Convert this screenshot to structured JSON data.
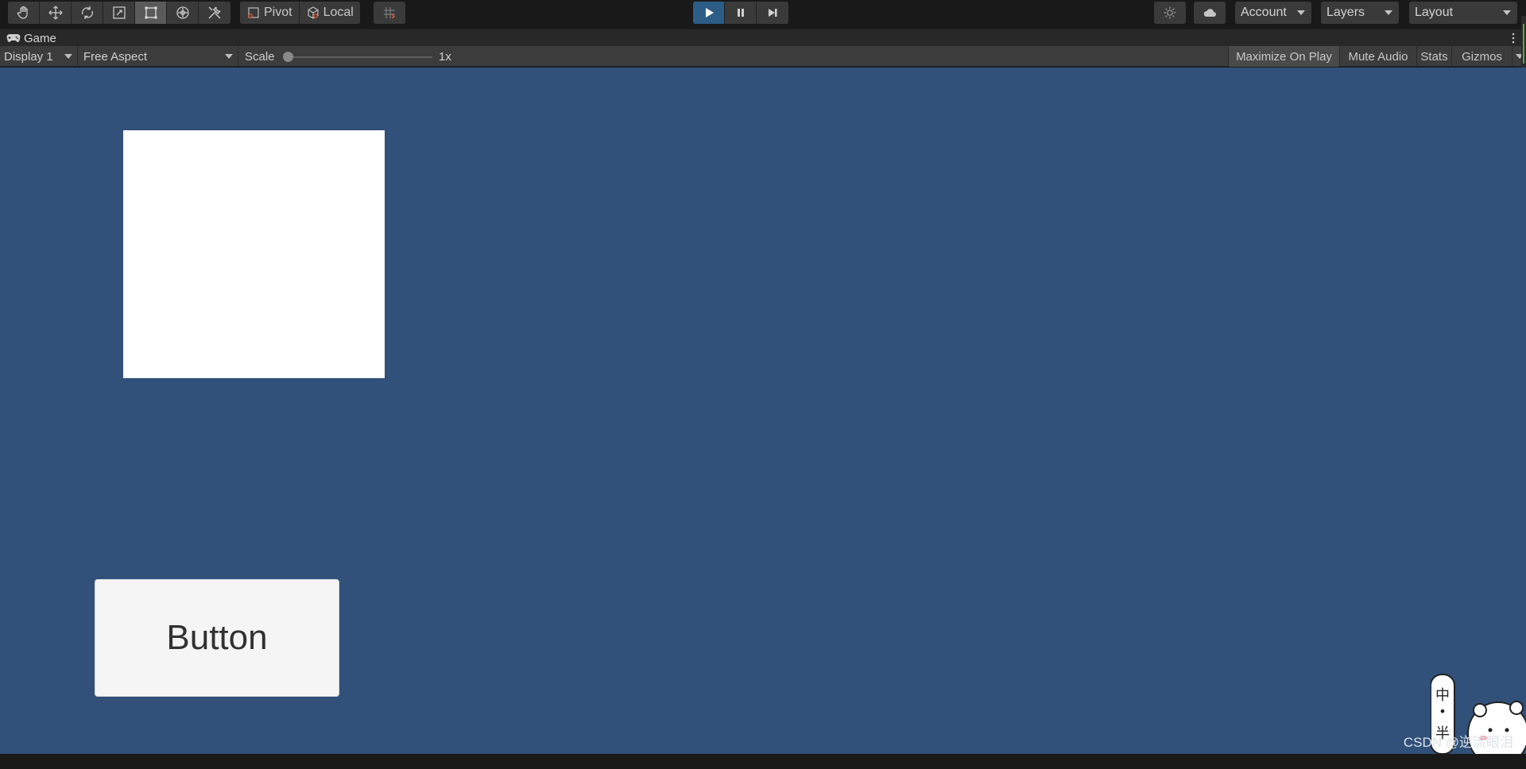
{
  "toolbar": {
    "tools": [
      {
        "name": "hand-tool",
        "icon": "hand-icon"
      },
      {
        "name": "move-tool",
        "icon": "move-icon"
      },
      {
        "name": "rotate-tool",
        "icon": "rotate-icon"
      },
      {
        "name": "scale-tool",
        "icon": "scale-icon"
      },
      {
        "name": "rect-tool",
        "icon": "rect-transform-icon",
        "active": true
      },
      {
        "name": "transform-tool",
        "icon": "transform-icon"
      },
      {
        "name": "custom-tool",
        "icon": "tools-icon"
      }
    ],
    "pivot_label": "Pivot",
    "local_label": "Local",
    "play_active": true,
    "account_label": "Account",
    "layers_label": "Layers",
    "layout_label": "Layout"
  },
  "game_tab": {
    "title": "Game"
  },
  "game_toolbar": {
    "display": "Display 1",
    "aspect": "Free Aspect",
    "scale_label": "Scale",
    "scale_value": "1x",
    "maximize_on_play": "Maximize On Play",
    "mute_audio": "Mute Audio",
    "stats": "Stats",
    "gizmos": "Gizmos"
  },
  "viewport": {
    "background": "#31507a",
    "button_label": "Button",
    "watermark": "CSDN @逆流眼泪"
  },
  "colors": {
    "accent_play": "#2c5d87",
    "toolbar_bg": "#191919"
  }
}
